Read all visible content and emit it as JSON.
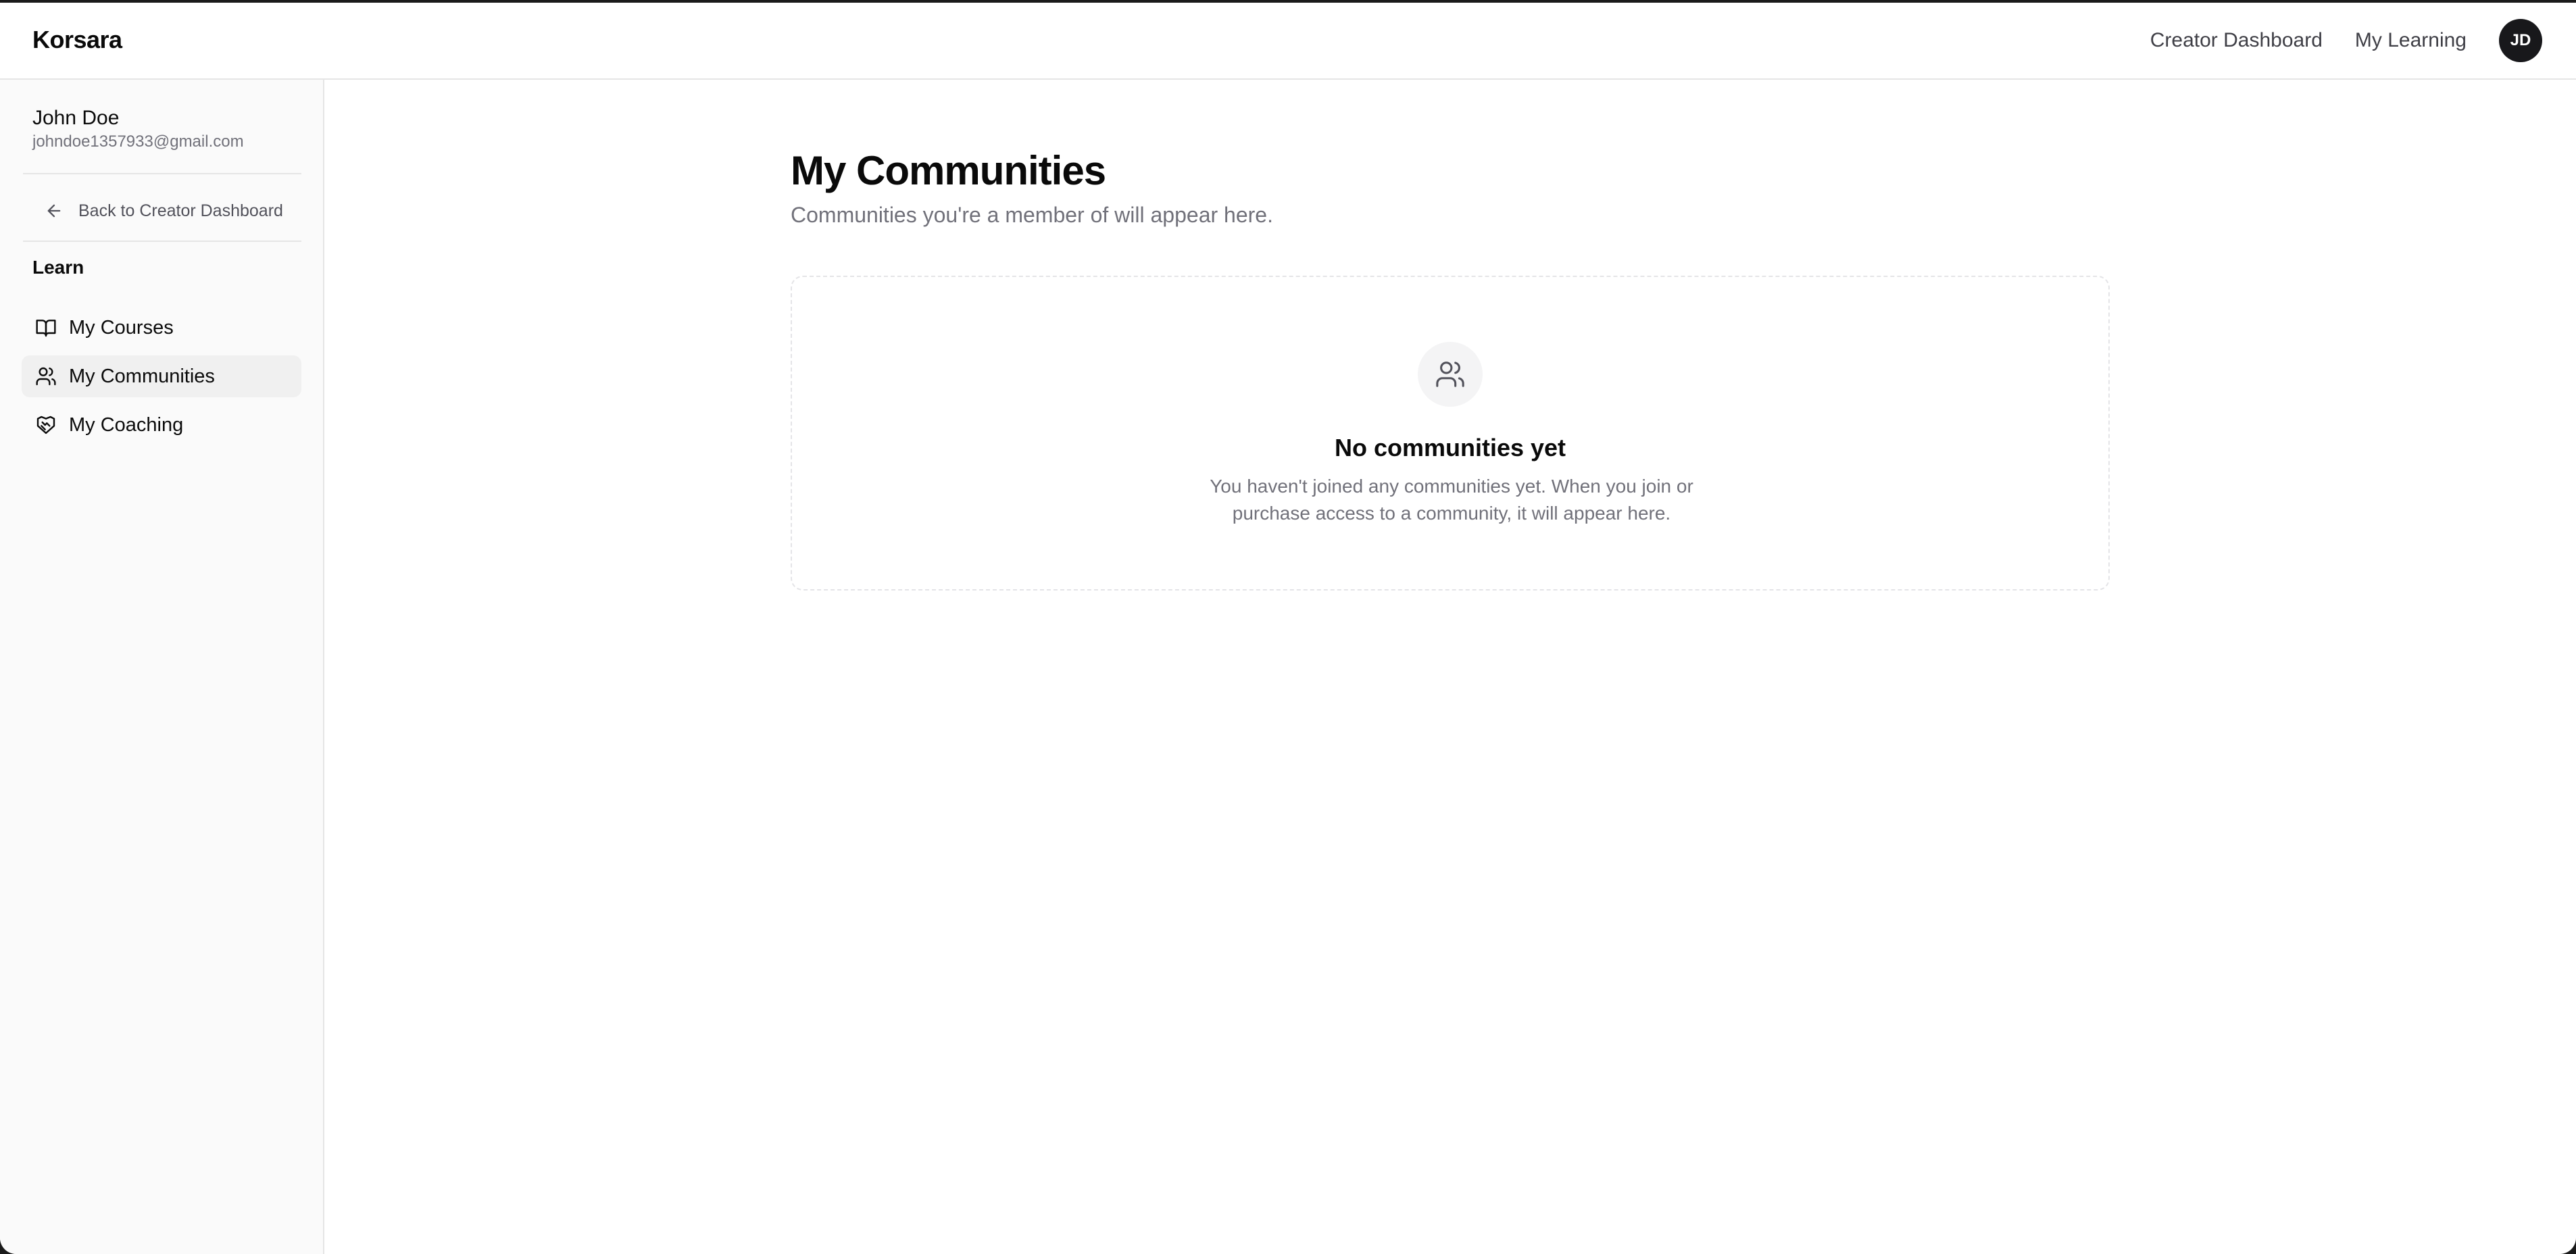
{
  "header": {
    "brand": "Korsara",
    "links": [
      "Creator Dashboard",
      "My Learning"
    ],
    "avatar_initials": "JD"
  },
  "sidebar": {
    "user": {
      "name": "John Doe",
      "email": "johndoe1357933@gmail.com"
    },
    "back_link": "Back to Creator Dashboard",
    "section_label": "Learn",
    "items": [
      {
        "label": "My Courses",
        "icon": "book-open-icon",
        "active": false
      },
      {
        "label": "My Communities",
        "icon": "users-icon",
        "active": true
      },
      {
        "label": "My Coaching",
        "icon": "handshake-icon",
        "active": false
      }
    ]
  },
  "main": {
    "title": "My Communities",
    "subtitle": "Communities you're a member of will appear here.",
    "empty_state": {
      "icon": "users-icon",
      "title": "No communities yet",
      "description": "You haven't joined any communities yet. When you join or purchase access to a community, it will appear here."
    }
  },
  "colors": {
    "text_primary": "#0a0a0a",
    "text_muted": "#71717a",
    "sidebar_bg": "#fafafa",
    "active_item_bg": "#f0f0f0",
    "avatar_bg": "#18181b",
    "border": "#e5e5e5"
  }
}
